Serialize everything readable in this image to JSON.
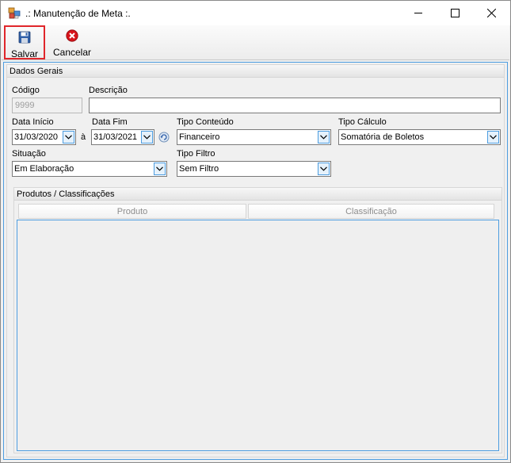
{
  "window": {
    "title": ".: Manutenção de Meta :.",
    "icons": {
      "app": "app-window-icon",
      "minimize": "minimize-icon",
      "maximize": "maximize-icon",
      "close": "close-icon"
    }
  },
  "toolbar": {
    "save_label": "Salvar",
    "cancel_label": "Cancelar",
    "save_icon": "floppy-disk-icon",
    "cancel_icon": "red-cancel-icon",
    "highlight_color": "#e0262b"
  },
  "dados_gerais": {
    "header": "Dados Gerais",
    "codigo_label": "Código",
    "codigo_value": "9999",
    "descricao_label": "Descrição",
    "descricao_value": "",
    "data_inicio_label": "Data Início",
    "data_inicio_value": "31/03/2020",
    "separator": "à",
    "data_fim_label": "Data Fim",
    "data_fim_value": "31/03/2021",
    "tipo_conteudo_label": "Tipo Conteúdo",
    "tipo_conteudo_value": "Financeiro",
    "tipo_calculo_label": "Tipo Cálculo",
    "tipo_calculo_value": "Somatória de Boletos",
    "situacao_label": "Situação",
    "situacao_value": "Em Elaboração",
    "tipo_filtro_label": "Tipo Filtro",
    "tipo_filtro_value": "Sem Filtro"
  },
  "produtos": {
    "header": "Produtos / Classificações",
    "columns": [
      "Produto",
      "Classificação"
    ]
  },
  "colors": {
    "accent": "#4d9de0",
    "window_bg": "#f0f0f0"
  }
}
